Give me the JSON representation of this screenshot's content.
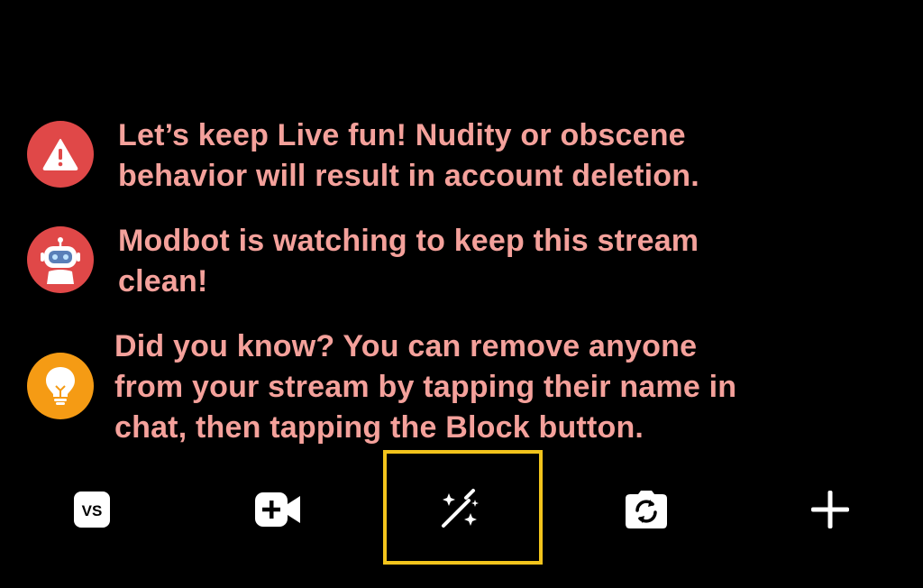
{
  "notices": [
    {
      "icon": "warning-icon",
      "color": "#e04848",
      "lines": [
        "Let’s keep Live fun! Nudity or obscene",
        "behavior will result in account deletion."
      ]
    },
    {
      "icon": "robot-icon",
      "color": "#e04848",
      "lines": [
        "Modbot is watching to keep this stream",
        "clean!"
      ]
    },
    {
      "icon": "lightbulb-icon",
      "color": "#f59b14",
      "lines": [
        "Did you know? You can remove anyone",
        "from your stream by tapping their name in",
        "chat, then tapping the Block button."
      ]
    }
  ],
  "toolbar": {
    "vs_label": "VS",
    "items": [
      "vs-icon",
      "video-camera-add-icon",
      "magic-wand-icon",
      "flip-camera-icon",
      "plus-icon"
    ]
  },
  "colors": {
    "notice_text": "#f4a19b",
    "highlight": "#f2c41c",
    "background": "#000000"
  }
}
